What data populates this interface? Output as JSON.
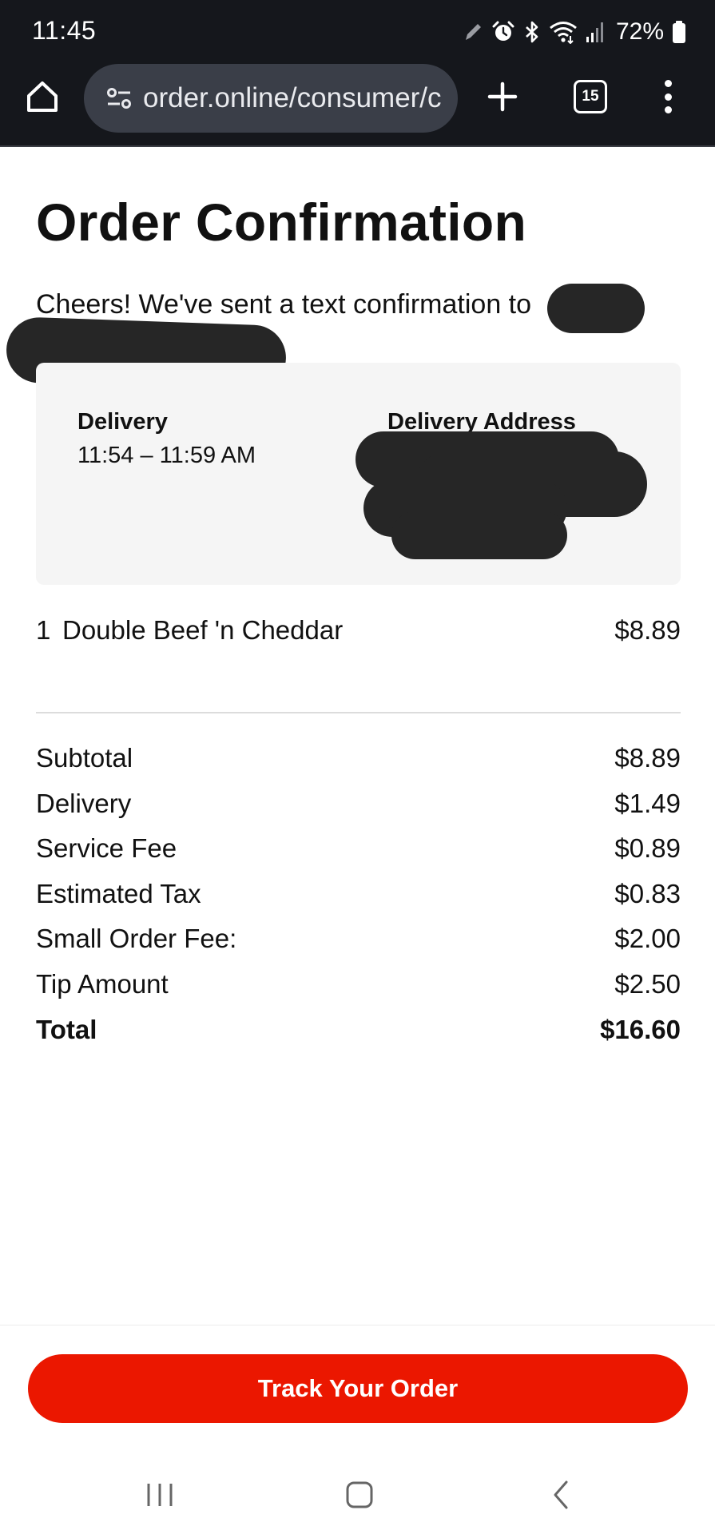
{
  "status_bar": {
    "time": "11:45",
    "battery": "72%",
    "icons": [
      "pen-icon",
      "alarm-icon",
      "bluetooth-icon",
      "wifi-icon",
      "signal-icon",
      "battery-icon"
    ]
  },
  "browser": {
    "url": "order.online/consumer/c",
    "tab_count": "15",
    "icons": [
      "home-icon",
      "site-settings-icon",
      "new-tab-plus-icon",
      "tab-switcher-icon",
      "more-menu-icon"
    ]
  },
  "page": {
    "title": "Order Confirmation",
    "confirmation_text": "Cheers! We've sent a text confirmation to"
  },
  "delivery_card": {
    "delivery_label": "Delivery",
    "delivery_window": "11:54 – 11:59 AM",
    "address_label": "Delivery Address"
  },
  "items": [
    {
      "qty": "1",
      "name": "Double Beef 'n Cheddar",
      "price": "$8.89"
    }
  ],
  "summary": {
    "subtotal_label": "Subtotal",
    "subtotal": "$8.89",
    "delivery_label": "Delivery",
    "delivery": "$1.49",
    "service_label": "Service Fee",
    "service": "$0.89",
    "tax_label": "Estimated Tax",
    "tax": "$0.83",
    "small_order_label": "Small Order Fee:",
    "small_order": "$2.00",
    "tip_label": "Tip Amount",
    "tip": "$2.50",
    "total_label": "Total",
    "total": "$16.60"
  },
  "actions": {
    "track_label": "Track Your Order"
  },
  "colors": {
    "accent": "#eb1700",
    "browser_bar": "#15171c",
    "card_bg": "#f5f5f5",
    "redaction": "#262626"
  },
  "nav": {
    "icons": [
      "recent-apps-icon",
      "home-nav-icon",
      "back-icon"
    ]
  }
}
